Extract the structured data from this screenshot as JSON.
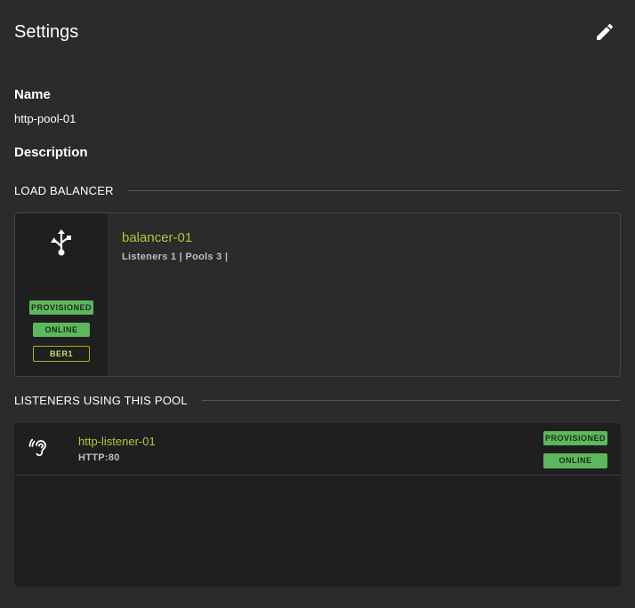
{
  "header": {
    "title": "Settings",
    "edit_icon": "pencil-icon"
  },
  "fields": {
    "name_label": "Name",
    "name_value": "http-pool-01",
    "description_label": "Description"
  },
  "load_balancer_section": {
    "title": "LOAD BALANCER",
    "card": {
      "icon": "usb-share-icon",
      "name": "balancer-01",
      "meta": "Listeners 1 | Pools 3 |",
      "badges": {
        "provisioned": "PROVISIONED",
        "online": "ONLINE",
        "location": "BER1"
      }
    }
  },
  "listeners_section": {
    "title": "LISTENERS USING THIS POOL",
    "items": [
      {
        "icon": "ear-icon",
        "name": "http-listener-01",
        "protocol": "HTTP:80",
        "badges": {
          "provisioned": "PROVISIONED",
          "online": "ONLINE"
        }
      }
    ]
  },
  "colors": {
    "background": "#2b2b2b",
    "card_dark": "#1f1f1f",
    "accent_link": "#b5c335",
    "status_green": "#5cb85c"
  }
}
